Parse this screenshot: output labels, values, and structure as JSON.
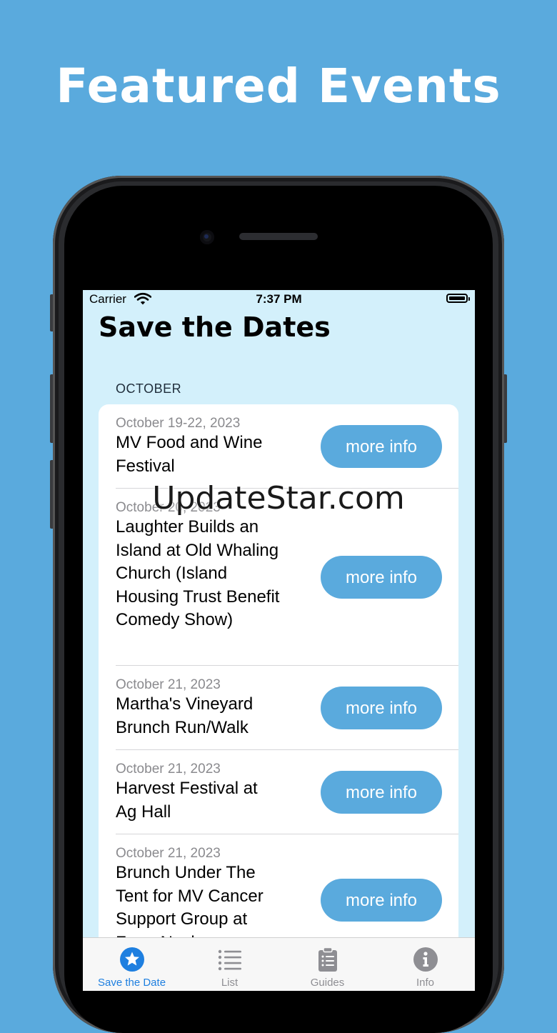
{
  "promo": {
    "headline": "Featured Events",
    "watermark": "UpdateStar.com"
  },
  "status_bar": {
    "carrier": "Carrier",
    "time": "7:37 PM"
  },
  "screen": {
    "title": "Save the Dates",
    "section": "OCTOBER",
    "events": [
      {
        "date": "October 19-22, 2023",
        "title": "MV Food and Wine Festival",
        "button": "more info"
      },
      {
        "date": "October 20, 2023",
        "title": "Laughter Builds an Island at Old Whaling Church (Island Housing Trust Benefit Comedy Show)",
        "button": "more info"
      },
      {
        "date": "October 21, 2023",
        "title": "Martha's Vineyard Brunch Run/Walk",
        "button": "more info"
      },
      {
        "date": "October 21, 2023",
        "title": "Harvest Festival at Ag Hall",
        "button": "more info"
      },
      {
        "date": "October 21, 2023",
        "title": "Brunch Under The Tent for MV Cancer Support Group at Farm Neck",
        "button": "more info"
      }
    ]
  },
  "tab_bar": {
    "tabs": [
      {
        "label": "Save the Date",
        "icon": "star-circle-icon",
        "active": true
      },
      {
        "label": "List",
        "icon": "list-icon",
        "active": false
      },
      {
        "label": "Guides",
        "icon": "clipboard-icon",
        "active": false
      },
      {
        "label": "Info",
        "icon": "info-icon",
        "active": false
      }
    ]
  },
  "colors": {
    "background": "#5aaadd",
    "screen_bg": "#d3f0fb",
    "accent": "#1e7fe0",
    "button": "#5aaadd"
  }
}
